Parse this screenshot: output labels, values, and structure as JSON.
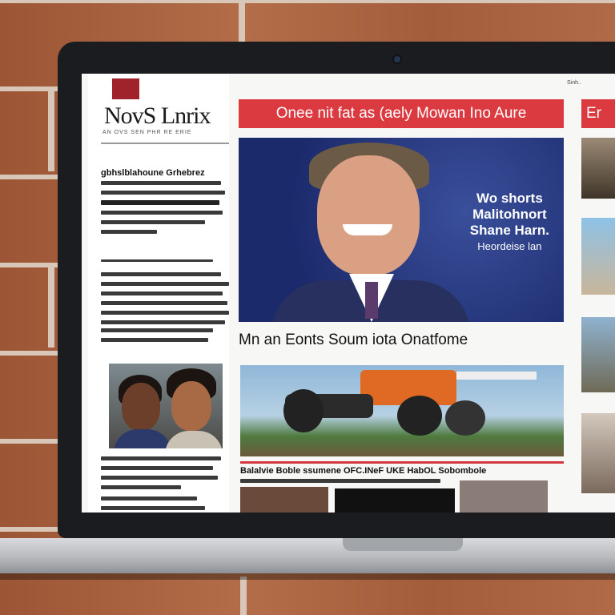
{
  "page": {
    "logo_text": "NovS Lnrix",
    "tagline": "AN OVS SEN PHR RE ERIE",
    "left_headline": "gbhslblahoune Grhebrez",
    "banner_headline": "Onee nit fat as (aely Mowan Ino  Aure",
    "hero": {
      "line1": "Wo shorts",
      "line2": "Malitohnort",
      "line3": "Shane Harn.",
      "line4": "Heordeise lan"
    },
    "subheadline": "Mn an Eonts Soum iota Onatfome",
    "caption": "Balalvie Boble ssumene OFC.INeF UKE HabOL Sobombole",
    "right_top": "Sinh..",
    "right_banner": "Er"
  },
  "colors": {
    "accent_red": "#db3a41",
    "hero_blue": "#1b2a6b",
    "logo_red": "#a0232b"
  }
}
